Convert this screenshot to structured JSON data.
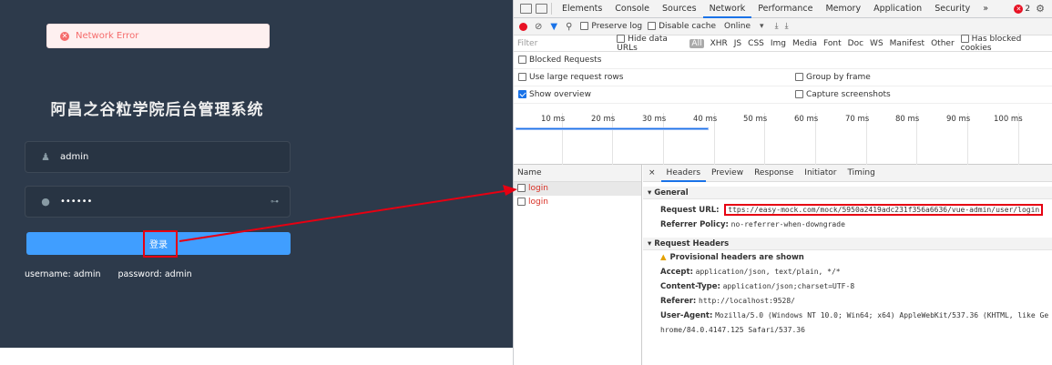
{
  "app": {
    "toast_message": "Network Error",
    "title": "阿昌之谷粒学院后台管理系统",
    "username_value": "admin",
    "password_value": "••••••",
    "login_button": "登录",
    "tip_username": "username: admin",
    "tip_password": "password: admin"
  },
  "devtools": {
    "tabs": [
      "Elements",
      "Console",
      "Sources",
      "Network",
      "Performance",
      "Memory",
      "Application",
      "Security",
      "»"
    ],
    "active_tab": "Network",
    "error_count": "2",
    "toolbar": {
      "preserve_log": "Preserve log",
      "disable_cache": "Disable cache",
      "throttle": "Online"
    },
    "filter": {
      "placeholder": "Filter",
      "hide_data_urls": "Hide data URLs",
      "types": [
        "All",
        "XHR",
        "JS",
        "CSS",
        "Img",
        "Media",
        "Font",
        "Doc",
        "WS",
        "Manifest",
        "Other"
      ],
      "has_blocked_cookies": "Has blocked cookies"
    },
    "options": {
      "blocked_requests": "Blocked Requests",
      "large_rows": "Use large request rows",
      "group_by_frame": "Group by frame",
      "show_overview": "Show overview",
      "capture_screenshots": "Capture screenshots"
    },
    "timeline_ticks": [
      "10 ms",
      "20 ms",
      "30 ms",
      "40 ms",
      "50 ms",
      "60 ms",
      "70 ms",
      "80 ms",
      "90 ms",
      "100 ms"
    ],
    "name_header": "Name",
    "requests": [
      "login",
      "login"
    ],
    "detail_tabs": [
      "×",
      "Headers",
      "Preview",
      "Response",
      "Initiator",
      "Timing"
    ],
    "general": {
      "title": "▾ General",
      "request_url_label": "Request URL:",
      "request_url": "ttps://easy-mock.com/mock/5950a2419adc231f356a6636/vue-admin/user/login",
      "referrer_label": "Referrer Policy:",
      "referrer": "no-referrer-when-downgrade"
    },
    "request_headers": {
      "title": "▾ Request Headers",
      "warning": "Provisional headers are shown",
      "accept_label": "Accept:",
      "accept": "application/json, text/plain, */*",
      "ctype_label": "Content-Type:",
      "ctype": "application/json;charset=UTF-8",
      "referer_label": "Referer:",
      "referer": "http://localhost:9528/",
      "ua_label": "User-Agent:",
      "ua": "Mozilla/5.0 (Windows NT 10.0; Win64; x64) AppleWebKit/537.36 (KHTML, like Ge",
      "ua_cont": "hrome/84.0.4147.125 Safari/537.36"
    }
  }
}
